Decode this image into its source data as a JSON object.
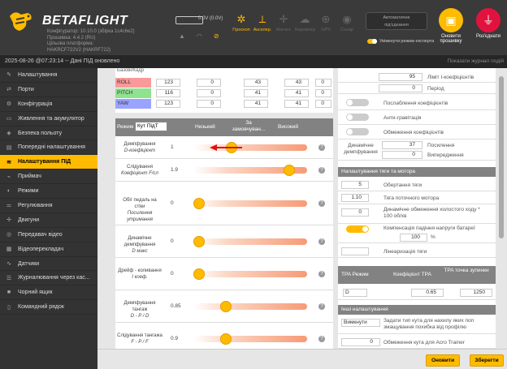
{
  "header": {
    "logo_text": "BETAFLIGHT",
    "fw_info": "Конфігуратор: 10.10.0 (збірка 1c4c6e2)\nПрошивка: 4.4.2 (RU)\nЦільова платформа:\nHAKRCF722V2 (HAKRF722)",
    "voltage": "0.0V (0.0V)",
    "sensors": [
      {
        "label": "Гіроскоп",
        "icon": "gyro-icon",
        "on": true
      },
      {
        "label": "Акселер.",
        "icon": "accel-icon",
        "on": true
      },
      {
        "label": "Магнет.",
        "icon": "mag-icon",
        "on": false
      },
      {
        "label": "Барометр",
        "icon": "baro-icon",
        "on": false
      },
      {
        "label": "GPS",
        "icon": "gps-icon",
        "on": false
      },
      {
        "label": "Сонар",
        "icon": "sonar-icon",
        "on": false
      }
    ],
    "conn_line1": "Автоматичне",
    "conn_line2": "під'єднання",
    "expert_mode": "Увімкнути режим експерта",
    "flash_btn": "Оновити прошивку",
    "disconnect_btn": "Роз'єднати",
    "colors": {
      "accent": "#ffbb00",
      "disconnect": "#e2123f"
    }
  },
  "datebar": {
    "text": "2025-08-26 @07:23:14 -- Дані ПІД оновлено",
    "log_link": "Показати журнал подій"
  },
  "sidebar": {
    "items": [
      {
        "label": "Налаштування",
        "icon": "wrench-icon",
        "active": false
      },
      {
        "label": "Порти",
        "icon": "ports-icon",
        "active": false
      },
      {
        "label": "Конфігурація",
        "icon": "config-icon",
        "active": false
      },
      {
        "label": "Живлення та акумулятор",
        "icon": "battery-icon",
        "active": false
      },
      {
        "label": "Безпека польоту",
        "icon": "shield-icon",
        "active": false
      },
      {
        "label": "Попередні налаштування",
        "icon": "presets-icon",
        "active": false
      },
      {
        "label": "Налаштування ПІД",
        "icon": "pid-icon",
        "active": true
      },
      {
        "label": "Приймач",
        "icon": "receiver-icon",
        "active": false
      },
      {
        "label": "Режими",
        "icon": "modes-icon",
        "active": false
      },
      {
        "label": "Регулювання",
        "icon": "adjust-icon",
        "active": false
      },
      {
        "label": "Двигуни",
        "icon": "motor-icon",
        "active": false
      },
      {
        "label": "Передавач відео",
        "icon": "vtx-icon",
        "active": false
      },
      {
        "label": "Відеоперекладач",
        "icon": "osd-icon",
        "active": false
      },
      {
        "label": "Датчики",
        "icon": "sensors-icon",
        "active": false
      },
      {
        "label": "Журналювання через кас...",
        "icon": "log-icon",
        "active": false
      },
      {
        "label": "Чорний ящик",
        "icon": "blackbox-icon",
        "active": false
      },
      {
        "label": "Командний рядок",
        "icon": "cli-icon",
        "active": false
      }
    ]
  },
  "pid": {
    "header": "Базові/Кадр",
    "rows": [
      {
        "name": "ROLL",
        "color": "#f99999",
        "values": [
          "123",
          "0",
          "43",
          "43",
          "0"
        ]
      },
      {
        "name": "PITCH",
        "color": "#8fe28f",
        "values": [
          "116",
          "0",
          "41",
          "41",
          "0"
        ]
      },
      {
        "name": "YAW",
        "color": "#9aa3ff",
        "values": [
          "123",
          "0",
          "41",
          "41",
          "0"
        ]
      }
    ]
  },
  "filter_header": {
    "mode_label": "Режим",
    "mode_value": "Кут ПідТ",
    "low": "Низький",
    "default": "За замовчуван...",
    "high": "Високий"
  },
  "sliders": [
    {
      "label": "Демпфування",
      "sub": "D-коефіцієнт",
      "value": "1",
      "pos": 0.32,
      "arrow": true
    },
    {
      "label": "Слідування",
      "sub": "Коефіцієнт F/сл",
      "value": "1.9",
      "pos": 0.88,
      "arrow": false
    },
    {
      "label": "Обіг педаль на стіки",
      "sub": "Посилення утримання",
      "value": "0",
      "pos": 0.0,
      "arrow": false
    },
    {
      "label": "Динамічне демпфування",
      "sub": "D макс",
      "value": "0",
      "pos": 0.0,
      "arrow": false
    },
    {
      "label": "Дрейф - коливання",
      "sub": "I коеф.",
      "value": "0",
      "pos": 0.0,
      "arrow": false
    },
    {
      "label": "Демпфування тангаж",
      "sub": "D - P / D",
      "value": "0.85",
      "pos": 0.26,
      "arrow": false
    },
    {
      "label": "Слідування тангажа",
      "sub": "F - P / F",
      "value": "0.9",
      "pos": 0.26,
      "arrow": false
    }
  ],
  "right_panel": {
    "top_rows": [
      {
        "value": "95",
        "label": "Ліміт І-коефіцієнтів"
      },
      {
        "value": "0",
        "label": "Період"
      }
    ],
    "switch_rows": [
      {
        "label": "Послаблення коефіцієнтів",
        "on": false
      },
      {
        "label": "Анти-гравітація",
        "on": false
      },
      {
        "label": "Обмеження коефіцієнтів",
        "on": false
      }
    ],
    "dyn_label": "Динамічне демпфування",
    "dyn_value1": "37",
    "dyn_label1": "Посилення",
    "dyn_value2": "0",
    "dyn_label2": "Випередження",
    "motor_header": "Налаштування тяги та мотора",
    "motor_rows": [
      {
        "value": "5",
        "label": "Обертання тяги"
      },
      {
        "value": "1.10",
        "label": "Тяга поточного мотора"
      },
      {
        "value": "0",
        "label": "Динамічне обмеження холостого ходу * 100 об/хв"
      }
    ],
    "comp_label": "Компенсація падіння напруги батареї",
    "comp_value": "100",
    "comp_unit": "%",
    "lin_label": "Лінеаризація тяги",
    "tpa_headers": [
      "TPA Режим",
      "Коефіцієнт TPA",
      "TPA точка зупинки"
    ],
    "tpa_values": [
      "D",
      "0.65",
      "1250"
    ],
    "other_header": "Інші налаштування",
    "other_rows": [
      {
        "value": "Вимкнути",
        "label": "Задати тип кута для нахилу яких поп змащування похибка від профілю"
      },
      {
        "value": "0",
        "label": "Обмеження кута для Acro Trainer"
      }
    ]
  },
  "bottom": {
    "refresh": "Оновити",
    "save": "Зберегти"
  }
}
